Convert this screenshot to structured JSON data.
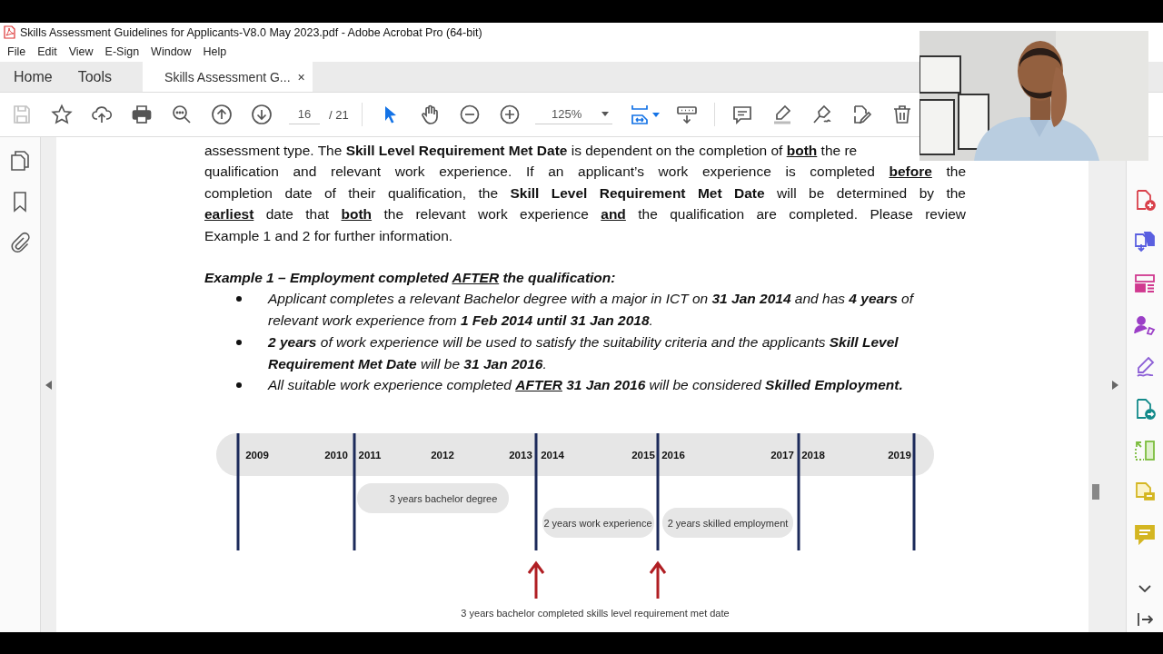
{
  "window": {
    "title": "Skills Assessment Guidelines for Applicants-V8.0 May 2023.pdf - Adobe Acrobat Pro (64-bit)"
  },
  "menu": [
    "File",
    "Edit",
    "View",
    "E-Sign",
    "Window",
    "Help"
  ],
  "tabs": [
    {
      "label": "Home",
      "selected": false,
      "closable": false
    },
    {
      "label": "Tools",
      "selected": false,
      "closable": false
    },
    {
      "label": "Skills Assessment G...",
      "selected": true,
      "closable": true
    }
  ],
  "tab_close": "×",
  "toolbar": {
    "tools_left": [
      {
        "kind": "save",
        "disabled": true
      },
      {
        "kind": "star",
        "disabled": false
      },
      {
        "kind": "upload",
        "disabled": false
      },
      {
        "kind": "print",
        "disabled": false
      },
      {
        "kind": "find",
        "disabled": false
      },
      {
        "kind": "prev-page",
        "disabled": false
      },
      {
        "kind": "next-page",
        "disabled": false
      }
    ],
    "page_current": "16",
    "page_total": "/ 21",
    "modes": [
      {
        "kind": "select",
        "selected": true
      },
      {
        "kind": "hand",
        "selected": false
      },
      {
        "kind": "zoom-out",
        "selected": false
      },
      {
        "kind": "zoom-in",
        "selected": false
      }
    ],
    "zoom": "125%",
    "tools_right": [
      {
        "kind": "fit"
      },
      {
        "kind": "scroll"
      },
      {
        "kind": "comment"
      },
      {
        "kind": "highlight"
      },
      {
        "kind": "sign"
      },
      {
        "kind": "edit"
      },
      {
        "kind": "delete"
      }
    ]
  },
  "left_panel": [
    {
      "kind": "pages"
    },
    {
      "kind": "bookmark"
    },
    {
      "kind": "attachment"
    }
  ],
  "document": {
    "paragraph_lines": [
      [
        {
          "text": "assessment type.  The ",
          "kind": "plain"
        },
        {
          "text": "Skill Level Requirement Met Date",
          "kind": "bold"
        },
        {
          "text": " is dependent on the completion of ",
          "kind": "plain"
        },
        {
          "text": "both",
          "kind": "stressed"
        },
        {
          "text": " the re",
          "kind": "plain"
        }
      ],
      [
        {
          "text": "qualification and relevant work experience. If an applicant’s work experience is completed ",
          "kind": "plain"
        },
        {
          "text": "before",
          "kind": "stressed"
        },
        {
          "text": " the",
          "kind": "plain"
        }
      ],
      [
        {
          "text": "completion date of their qualification, the ",
          "kind": "plain"
        },
        {
          "text": "Skill Level Requirement Met Date",
          "kind": "bold"
        },
        {
          "text": " will be determined by the",
          "kind": "plain"
        }
      ],
      [
        {
          "text": "earliest",
          "kind": "stressed"
        },
        {
          "text": " date that ",
          "kind": "plain"
        },
        {
          "text": "both",
          "kind": "stressed"
        },
        {
          "text": " the relevant work experience ",
          "kind": "plain"
        },
        {
          "text": "and",
          "kind": "stressed"
        },
        {
          "text": " the qualification are completed. Please review",
          "kind": "plain"
        }
      ],
      [
        {
          "text": "Example 1 and 2 for further information.",
          "kind": "plain"
        }
      ]
    ],
    "example_heading": [
      {
        "text": "Example 1 – Employment completed ",
        "kind": "plain"
      },
      {
        "text": "AFTER",
        "kind": "underlined"
      },
      {
        "text": " the qualification:",
        "kind": "plain"
      }
    ],
    "bullets": [
      [
        {
          "text": "Applicant completes a relevant Bachelor degree with a major in ICT on ",
          "kind": "plain"
        },
        {
          "text": "31 Jan 2014",
          "kind": "bold"
        },
        {
          "text": " and has ",
          "kind": "plain"
        },
        {
          "text": "4 years",
          "kind": "bold"
        },
        {
          "text": " of relevant work experience from ",
          "kind": "plain"
        },
        {
          "text": "1 Feb 2014 until 31 Jan 2018",
          "kind": "bold"
        },
        {
          "text": ".",
          "kind": "plain"
        }
      ],
      [
        {
          "text": "2 years",
          "kind": "bold"
        },
        {
          "text": " of work experience will be used to satisfy the suitability criteria and the applicants ",
          "kind": "plain"
        },
        {
          "text": "Skill Level Requirement Met Date",
          "kind": "bold"
        },
        {
          "text": " will be ",
          "kind": "plain"
        },
        {
          "text": "31 Jan 2016",
          "kind": "bold"
        },
        {
          "text": ".",
          "kind": "plain"
        }
      ],
      [
        {
          "text": "All suitable work experience completed ",
          "kind": "plain"
        },
        {
          "text": "AFTER",
          "kind": "stressed"
        },
        {
          "text": " 31 Jan 2016",
          "kind": "bold"
        },
        {
          "text": " will be considered ",
          "kind": "plain"
        },
        {
          "text": "Skilled Employment.",
          "kind": "bold"
        }
      ]
    ],
    "timeline": {
      "years": [
        "2009",
        "2010",
        "2011",
        "2012",
        "2013",
        "2014",
        "2015",
        "2016",
        "2017",
        "2018",
        "2019"
      ],
      "bars": [
        "3 years bachelor degree",
        "2 years work experience",
        "2 years skilled employment"
      ],
      "caption": "3 years bachelor completed skills level requirement met date"
    }
  },
  "right_tools": [
    {
      "kind": "create"
    },
    {
      "kind": "combine"
    },
    {
      "kind": "organize"
    },
    {
      "kind": "request-sign"
    },
    {
      "kind": "fill-sign"
    },
    {
      "kind": "export"
    },
    {
      "kind": "compress"
    },
    {
      "kind": "protect"
    },
    {
      "kind": "comment"
    }
  ]
}
